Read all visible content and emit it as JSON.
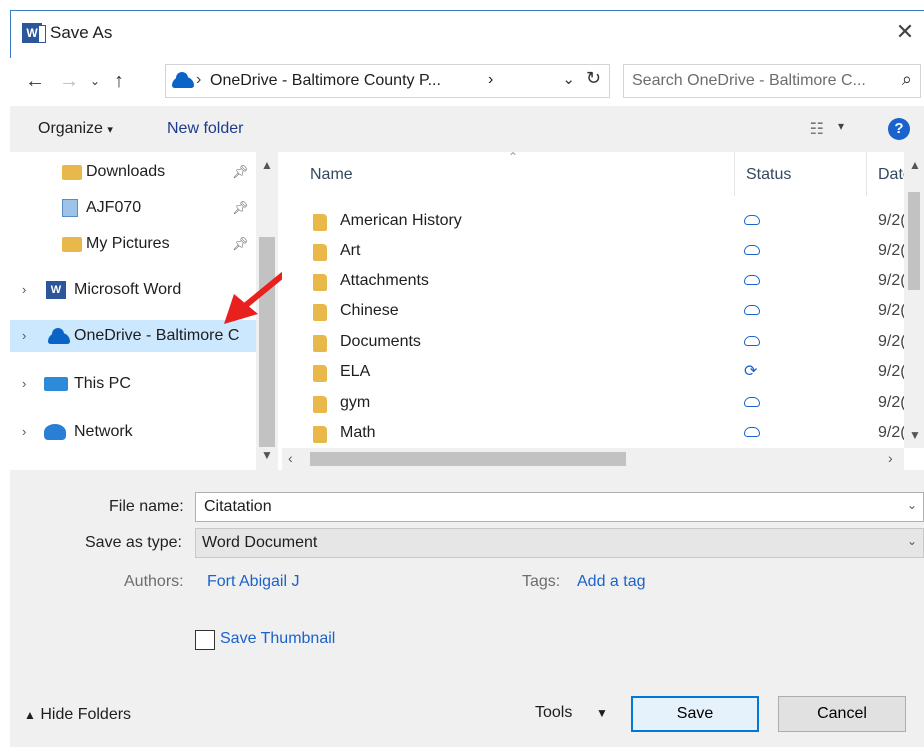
{
  "window": {
    "title": "Save As",
    "close": "✕"
  },
  "address": {
    "path_label": "OneDrive - Baltimore County P...",
    "search_placeholder": "Search OneDrive - Baltimore C..."
  },
  "toolbar": {
    "organize": "Organize",
    "new_folder": "New folder",
    "help": "?"
  },
  "nav": {
    "items": [
      {
        "label": "Downloads"
      },
      {
        "label": "AJF070"
      },
      {
        "label": "My Pictures"
      },
      {
        "label": "Microsoft Word"
      },
      {
        "label": "OneDrive - Baltimore C"
      },
      {
        "label": "This PC"
      },
      {
        "label": "Network"
      }
    ]
  },
  "filelist": {
    "columns": {
      "name": "Name",
      "status": "Status",
      "date": "Date"
    },
    "rows": [
      {
        "name": "American History",
        "status": "cloud",
        "date": "9/2("
      },
      {
        "name": "Art",
        "status": "cloud",
        "date": "9/2("
      },
      {
        "name": "Attachments",
        "status": "cloud",
        "date": "9/2("
      },
      {
        "name": "Chinese",
        "status": "cloud",
        "date": "9/2("
      },
      {
        "name": "Documents",
        "status": "cloud",
        "date": "9/2("
      },
      {
        "name": "ELA",
        "status": "sync",
        "date": "9/2("
      },
      {
        "name": "gym",
        "status": "cloud",
        "date": "9/2("
      },
      {
        "name": "Math",
        "status": "cloud",
        "date": "9/2("
      }
    ]
  },
  "form": {
    "file_name_label": "File name:",
    "file_name_value": "Citatation",
    "save_type_label": "Save as type:",
    "save_type_value": "Word Document",
    "authors_label": "Authors:",
    "authors_value": "Fort Abigail J",
    "tags_label": "Tags:",
    "tags_value": "Add a tag",
    "thumbnail_label": "Save Thumbnail"
  },
  "footer": {
    "hide_folders": "Hide Folders",
    "tools": "Tools",
    "save": "Save",
    "cancel": "Cancel"
  },
  "colors": {
    "accent": "#0078d7",
    "selected": "#cce8ff",
    "link": "#1a63cc",
    "annotation_arrow": "#e8201e"
  }
}
